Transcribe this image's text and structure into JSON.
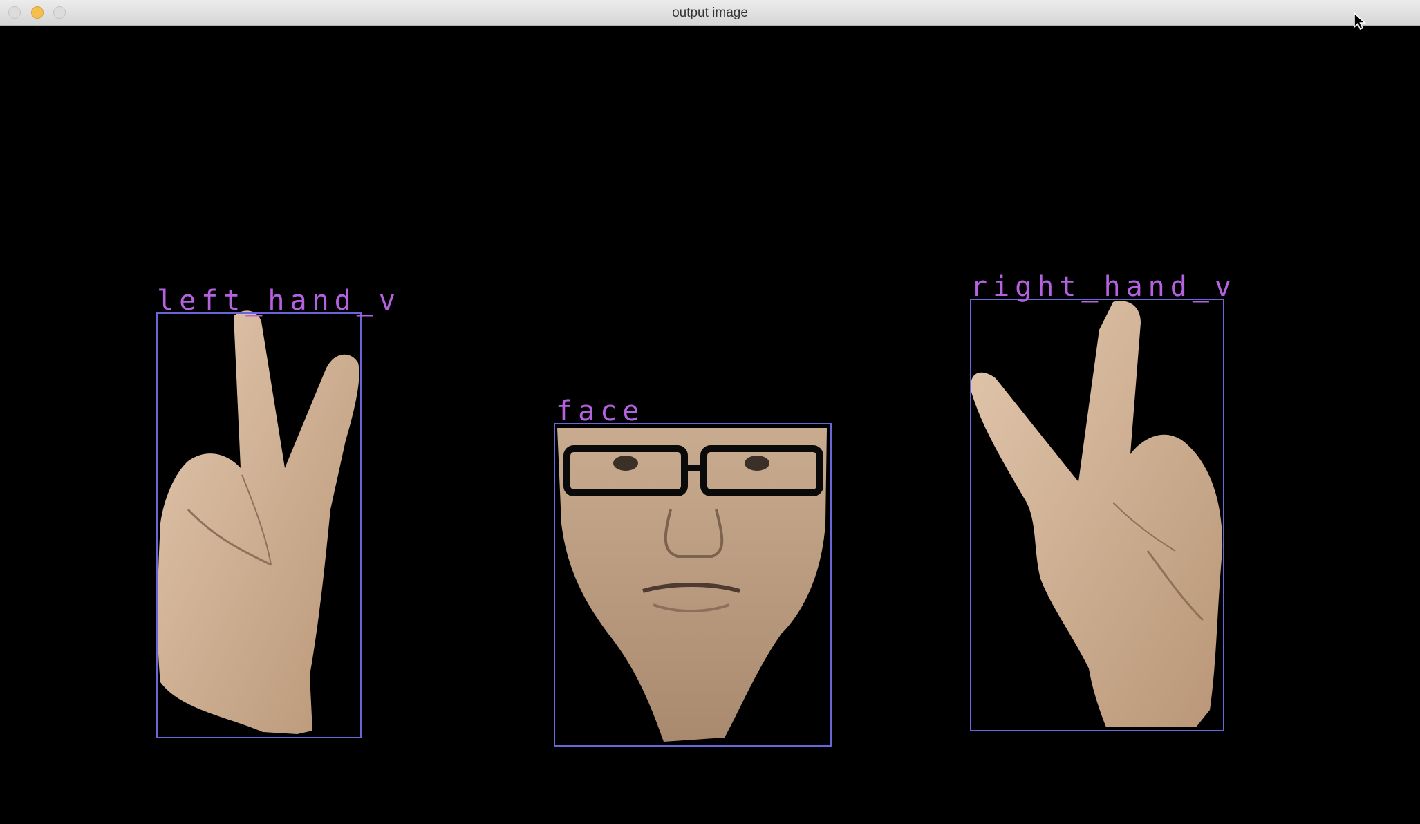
{
  "window": {
    "title": "output image",
    "controls": [
      "close-button",
      "minimize-button",
      "zoom-button"
    ]
  },
  "detections": [
    {
      "label": "left_hand_v",
      "kind": "hand"
    },
    {
      "label": "face",
      "kind": "face"
    },
    {
      "label": "right_hand_v",
      "kind": "hand"
    }
  ],
  "colors": {
    "box": "#6a66d8",
    "label": "#b562e0",
    "background": "#000000",
    "skin": "#d6b79a"
  }
}
